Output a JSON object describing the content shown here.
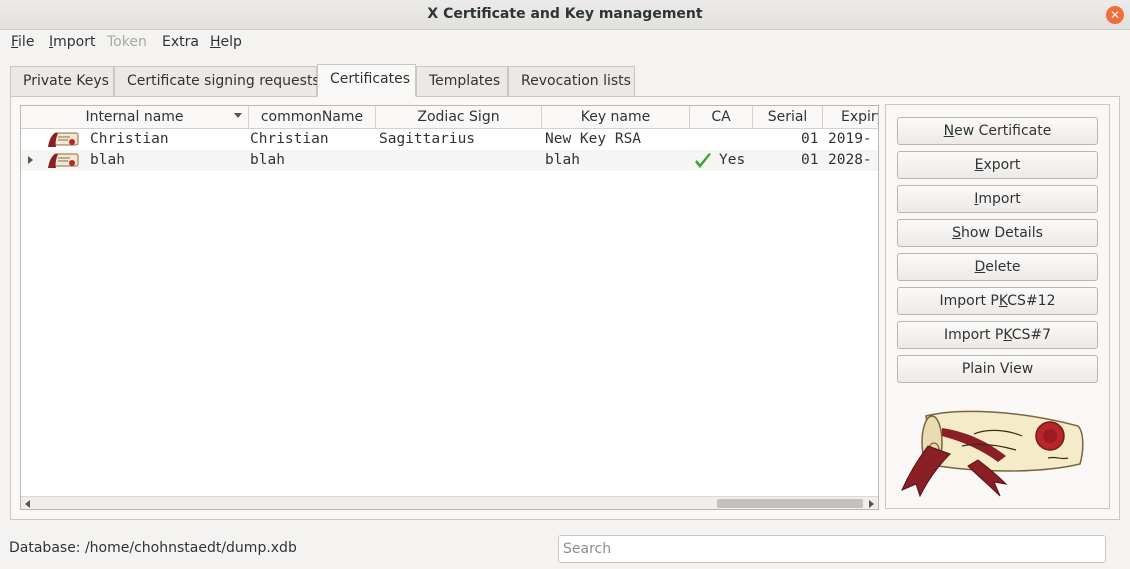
{
  "window": {
    "title": "X Certificate and Key management",
    "close_glyph": "✕"
  },
  "menu": {
    "file": {
      "m": "F",
      "rest": "ile"
    },
    "import": {
      "m": "I",
      "rest": "mport"
    },
    "token": {
      "label": "Token"
    },
    "extra": {
      "label": "Extra"
    },
    "help": {
      "m": "H",
      "rest": "elp"
    }
  },
  "tabs": [
    "Private Keys",
    "Certificate signing requests",
    "Certificates",
    "Templates",
    "Revocation lists"
  ],
  "active_tab": "Certificates",
  "table": {
    "columns": [
      "Internal name",
      "commonName",
      "Zodiac Sign",
      "Key name",
      "CA",
      "Serial",
      "Expiry"
    ],
    "rows": [
      {
        "internal_name": "Christian",
        "common_name": "Christian",
        "zodiac": "Sagittarius",
        "key_name": "New Key RSA",
        "ca": "",
        "serial": "01",
        "expiry": "2019-"
      },
      {
        "internal_name": "blah",
        "common_name": "blah",
        "zodiac": "",
        "key_name": "blah",
        "ca": "Yes",
        "serial": "01",
        "expiry": "2028-"
      }
    ]
  },
  "buttons": {
    "new_certificate": {
      "m": "N",
      "rest": "ew Certificate"
    },
    "export": {
      "m": "E",
      "rest": "xport"
    },
    "import": {
      "m": "I",
      "rest": "mport"
    },
    "show_details": {
      "m": "S",
      "rest": "how Details"
    },
    "delete": {
      "m": "D",
      "rest": "elete"
    },
    "import_pkcs12": {
      "pre": "Import P",
      "m": "K",
      "rest": "CS#12"
    },
    "import_pkcs7": {
      "pre": "Import P",
      "m": "K",
      "rest": "CS#7"
    },
    "plain_view": {
      "label": "Plain View"
    }
  },
  "status": {
    "database": "Database: /home/chohnstaedt/dump.xdb"
  },
  "search": {
    "placeholder": "Search",
    "value": ""
  },
  "colors": {
    "accent": "#ef6e3a",
    "check": "#3ca532",
    "seal": "#b8262a"
  }
}
